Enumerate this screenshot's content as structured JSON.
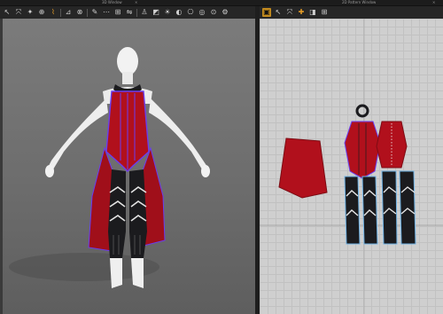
{
  "windows": {
    "left_title": "3D Window",
    "right_title": "2D Pattern Window",
    "close_glyph": "×"
  },
  "toolbar_3d": {
    "icons": [
      "select-icon",
      "transform-icon",
      "pin-icon",
      "tack-icon",
      "fold-icon",
      "measure-icon",
      "tape-icon",
      "brush-icon",
      "stitch-icon",
      "grid-icon",
      "symmetry-icon",
      "avatar-icon",
      "texture-icon",
      "light-icon",
      "render-icon",
      "camera-icon",
      "xray-icon",
      "skin-icon",
      "settings-icon"
    ],
    "glyphs": [
      "↖",
      "⤧",
      "✦",
      "⊕",
      "⌇",
      "⊿",
      "⊗",
      "✎",
      "⋯",
      "⊞",
      "⇋",
      "♙",
      "◩",
      "☀",
      "◐",
      "⎔",
      "◎",
      "⊙",
      "⚙"
    ]
  },
  "toolbar_2d": {
    "icons": [
      "select-icon",
      "transform-icon",
      "segment-icon",
      "color-icon",
      "layout-icon"
    ],
    "glyphs": [
      "▣",
      "↖",
      "⤧",
      "✚",
      "◨",
      "⊞"
    ]
  },
  "colors": {
    "garment_red": "#b1101c",
    "garment_dark": "#1b1b1e",
    "trim_purple": "#6a3df0",
    "avatar_white": "#f0f0f0",
    "active_tool": "#c28a1e"
  }
}
